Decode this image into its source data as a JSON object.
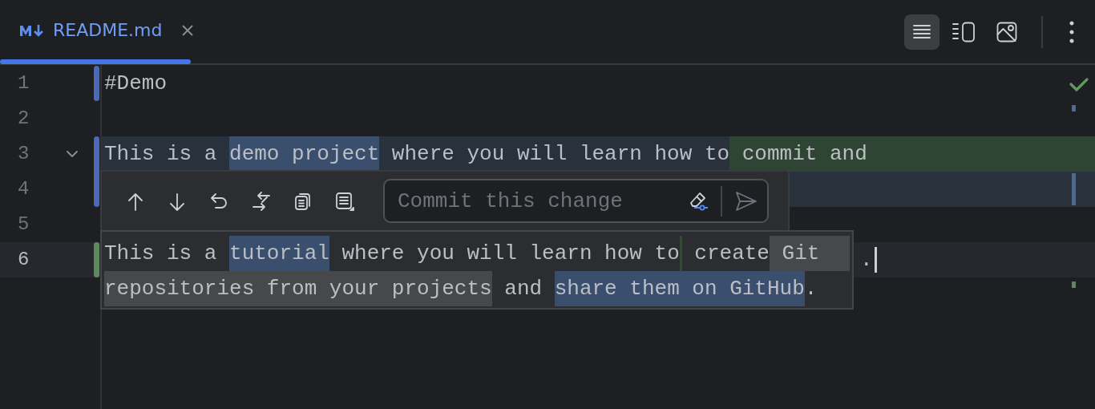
{
  "tab": {
    "label": "README.md",
    "selected": true
  },
  "view_modes": [
    {
      "kind": "editor",
      "selected": true
    },
    {
      "kind": "split",
      "selected": false
    },
    {
      "kind": "preview",
      "selected": false
    }
  ],
  "inspection": {
    "kind": "ok"
  },
  "lines": [
    {
      "number": "1",
      "current": false,
      "gutter_marker": {
        "kind": "modified"
      },
      "foldable": false,
      "cursor": false,
      "segments": [
        {
          "text": "#Demo",
          "kind": "plain"
        }
      ]
    },
    {
      "number": "2",
      "current": false,
      "foldable": false,
      "cursor": false,
      "stripe": {
        "kind": "modified"
      }
    },
    {
      "number": "3",
      "current": false,
      "gutter_marker": {
        "kind": "modified"
      },
      "background": {
        "kind": "modified"
      },
      "foldable": true,
      "cursor": false,
      "segments": [
        {
          "text": "This is a ",
          "kind": "plain"
        },
        {
          "text": "demo project",
          "kind": "word"
        },
        {
          "text": " where you will learn how to",
          "kind": "plain"
        },
        {
          "text": " commit and",
          "kind": "inserted",
          "extends": true
        }
      ]
    },
    {
      "number": "4",
      "current": false,
      "gutter_marker": {
        "kind": "modified"
      },
      "background": {
        "kind": "modified"
      },
      "foldable": false,
      "stripe": {
        "kind": "modified"
      }
    },
    {
      "number": "5",
      "current": false,
      "foldable": false
    },
    {
      "number": "6",
      "current": true,
      "gutter_marker": {
        "kind": "added"
      },
      "foldable": false,
      "cursor": true,
      "covered": true,
      "segments": [
        {
          "text": ".",
          "kind": "plain"
        }
      ]
    },
    {
      "foldable": false,
      "current": false,
      "stripe": {
        "kind": "added"
      }
    }
  ],
  "change_popup": {
    "actions": [
      {
        "kind": "previous"
      },
      {
        "kind": "next"
      },
      {
        "kind": "rollback"
      },
      {
        "kind": "compare"
      },
      {
        "kind": "copy"
      },
      {
        "kind": "format"
      }
    ],
    "commit_field": {
      "placeholder": "Commit this change"
    },
    "old_text": [
      [
        {
          "text": "This is a ",
          "kind": "plain"
        },
        {
          "text": "tutorial",
          "kind": "word"
        },
        {
          "text": " where you will learn how to",
          "kind": "plain"
        },
        {
          "kind": "insertion-point"
        },
        {
          "text": " create",
          "kind": "plain"
        },
        {
          "text": " Git",
          "kind": "deleted",
          "extends": true
        }
      ],
      [
        {
          "text": "repositories from your projects",
          "kind": "deleted"
        },
        {
          "text": " and ",
          "kind": "plain"
        },
        {
          "text": "share them on GitHub",
          "kind": "word"
        },
        {
          "text": ".",
          "kind": "plain"
        }
      ]
    ]
  }
}
